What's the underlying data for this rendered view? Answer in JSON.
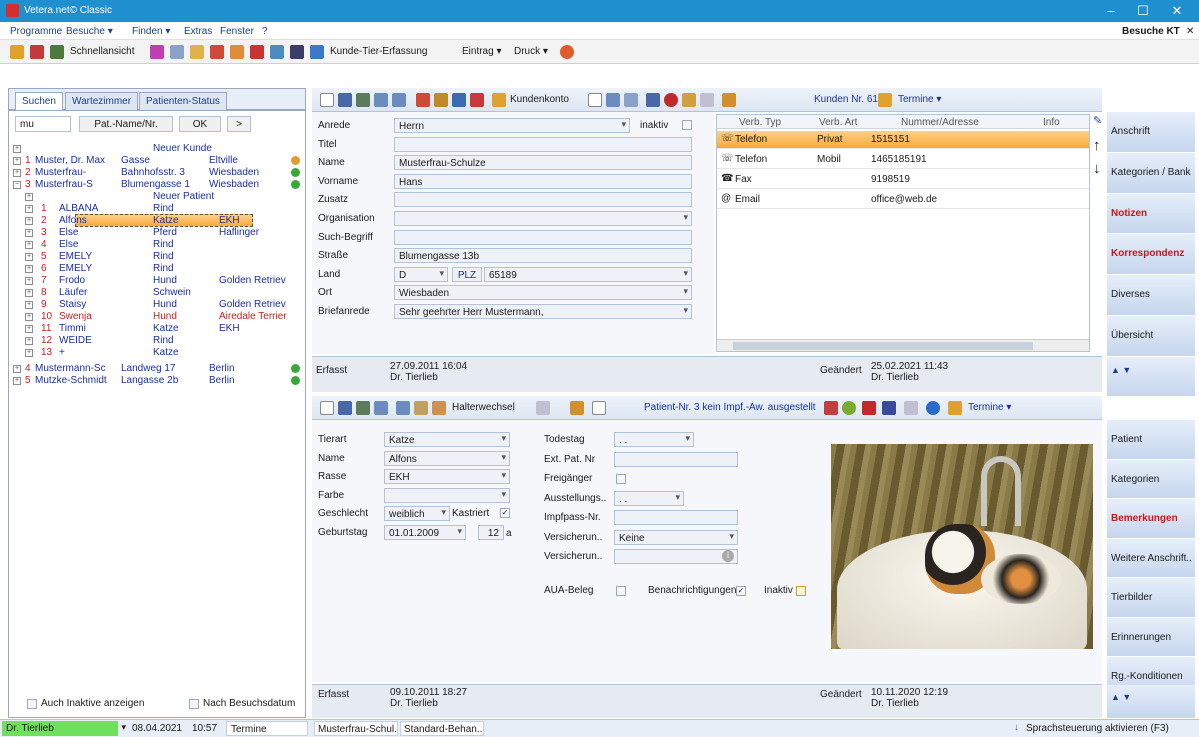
{
  "app": {
    "title": "Vetera.net© Classic"
  },
  "menu": {
    "items": [
      "Programme",
      "Besuche ▾",
      "Finden ▾",
      "Extras",
      "Fenster",
      "?"
    ],
    "right": "Besuche KT"
  },
  "toolbar": {
    "quickview": "Schnellansicht",
    "kunde_tier": "Kunde-Tier-Erfassung",
    "eintrag": "Eintrag ▾",
    "druck": "Druck ▾"
  },
  "left": {
    "tabs": [
      "Suchen",
      "Wartezimmer",
      "Patienten-Status"
    ],
    "search_value": "mu",
    "search_mode": "Pat.-Name/Nr.",
    "ok": "OK",
    "more": ">",
    "new_customer": "Neuer Kunde",
    "customers": [
      {
        "no": "1",
        "name": "Muster, Dr. Max",
        "street": "Gasse",
        "city": "Eltville"
      },
      {
        "no": "2",
        "name": "Musterfrau-",
        "street": "Bahnhofsstr. 3",
        "city": "Wiesbaden"
      },
      {
        "no": "3",
        "name": "Musterfrau-S",
        "street": "Blumengasse 1",
        "city": "Wiesbaden"
      }
    ],
    "new_patient": "Neuer Patient",
    "patients": [
      {
        "no": "1",
        "name": "ALBANA",
        "species": "Rind",
        "breed": ""
      },
      {
        "no": "2",
        "name": "Alfons",
        "species": "Katze",
        "breed": "EKH"
      },
      {
        "no": "3",
        "name": "Else",
        "species": "Pferd",
        "breed": "Haflinger"
      },
      {
        "no": "4",
        "name": "Else",
        "species": "Rind",
        "breed": ""
      },
      {
        "no": "5",
        "name": "EMELY",
        "species": "Rind",
        "breed": ""
      },
      {
        "no": "6",
        "name": "EMELY",
        "species": "Rind",
        "breed": ""
      },
      {
        "no": "7",
        "name": "Frodo",
        "species": "Hund",
        "breed": "Golden Retriev"
      },
      {
        "no": "8",
        "name": "Läufer",
        "species": "Schwein",
        "breed": ""
      },
      {
        "no": "9",
        "name": "Staisy",
        "species": "Hund",
        "breed": "Golden Retriev"
      },
      {
        "no": "10",
        "name": "Swenja",
        "species": "Hund",
        "breed": "Airedale Terrier"
      },
      {
        "no": "11",
        "name": "Timmi",
        "species": "Katze",
        "breed": "EKH"
      },
      {
        "no": "12",
        "name": "WEIDE",
        "species": "Rind",
        "breed": ""
      },
      {
        "no": "13",
        "name": "+",
        "species": "Katze",
        "breed": ""
      }
    ],
    "customers2": [
      {
        "no": "4",
        "name": "Mustermann-Sc",
        "street": "Landweg 17",
        "city": "Berlin"
      },
      {
        "no": "5",
        "name": "Mutzke-Schmidt",
        "street": "Langasse 2b",
        "city": "Berlin"
      }
    ],
    "inactive_label": "Auch Inaktive anzeigen",
    "visit_date_label": "Nach Besuchsdatum"
  },
  "customer": {
    "toolbar_konto": "Kundenkonto",
    "kunden_nr": "Kunden Nr. 61",
    "termine": "Termine ▾",
    "labels": [
      "Anrede",
      "Titel",
      "Name",
      "Vorname",
      "Zusatz",
      "Organisation",
      "Such-Begriff",
      "Straße",
      "Land",
      "Ort",
      "Briefanrede"
    ],
    "anrede": "Herrn",
    "inaktiv": "inaktiv",
    "titel": "",
    "name": "Musterfrau-Schulze",
    "vorname": "Hans",
    "zusatz": "",
    "organisation": "",
    "such": "",
    "strasse": "Blumengasse 13b",
    "land": "D",
    "plz_label": "PLZ",
    "plz": "65189",
    "ort": "Wiesbaden",
    "briefanrede": "Sehr geehrter Herr Mustermann,",
    "contacts_header": [
      "Verb. Typ",
      "Verb. Art",
      "Nummer/Adresse",
      "Info"
    ],
    "contacts": [
      {
        "type": "Telefon",
        "art": "Privat",
        "nr": "1515151"
      },
      {
        "type": "Telefon",
        "art": "Mobil",
        "nr": "1465185191"
      },
      {
        "type": "Fax",
        "art": "",
        "nr": "9198519"
      },
      {
        "type": "Email",
        "art": "",
        "nr": "office@web.de"
      }
    ],
    "erfasst_label": "Erfasst",
    "erfasst": "27.09.2011 16:04",
    "erfasst_by": "Dr. Tierlieb",
    "geaendert_label": "Geändert",
    "geaendert": "25.02.2021 11:43",
    "geaendert_by": "Dr. Tierlieb"
  },
  "customer_side": [
    "Anschrift",
    "Kategorien / Bank",
    "Notizen",
    "Korrespondenz",
    "Diverses",
    "Übersicht"
  ],
  "patient": {
    "halterwechsel": "Halterwechsel",
    "info": "Patient-Nr. 3 kein Impf.-Aw. ausgestellt",
    "termine": "Termine ▾",
    "labels": [
      "Tierart",
      "Name",
      "Rasse",
      "Farbe",
      "Geschlecht",
      "Geburtstag"
    ],
    "tierart": "Katze",
    "name": "Alfons",
    "rasse": "EKH",
    "farbe": "",
    "geschlecht": "weiblich",
    "kastriert": "Kastriert",
    "geburtstag": "01.01.2009",
    "alter": "12",
    "alter_unit": "a",
    "labels2": [
      "Todestag",
      "Ext. Pat. Nr",
      "Freigänger",
      "Ausstellungs..",
      "Impfpass-Nr.",
      "Versicherun..",
      "Versicherun.."
    ],
    "todestag": ". .",
    "ausstellung": ". .",
    "versicherung": "Keine",
    "aua": "AUA-Beleg",
    "benachrichtigungen": "Benachrichtigungen",
    "inaktiv": "Inaktiv",
    "erfasst_label": "Erfasst",
    "erfasst": "09.10.2011 18:27",
    "erfasst_by": "Dr. Tierlieb",
    "geaendert_label": "Geändert",
    "geaendert": "10.11.2020 12:19",
    "geaendert_by": "Dr. Tierlieb"
  },
  "patient_side": [
    "Patient",
    "Kategorien",
    "Bemerkungen",
    "Weitere Anschrift..",
    "Tierbilder",
    "Erinnerungen",
    "Rg.-Konditionen"
  ],
  "status": {
    "user": "Dr. Tierlieb",
    "date": "08.04.2021",
    "time": "10:57",
    "termine": "Termine",
    "doc1": "Musterfrau-Schul...",
    "doc2": "Standard-Behan...",
    "voice": "Sprachsteuerung aktivieren (F3)"
  }
}
